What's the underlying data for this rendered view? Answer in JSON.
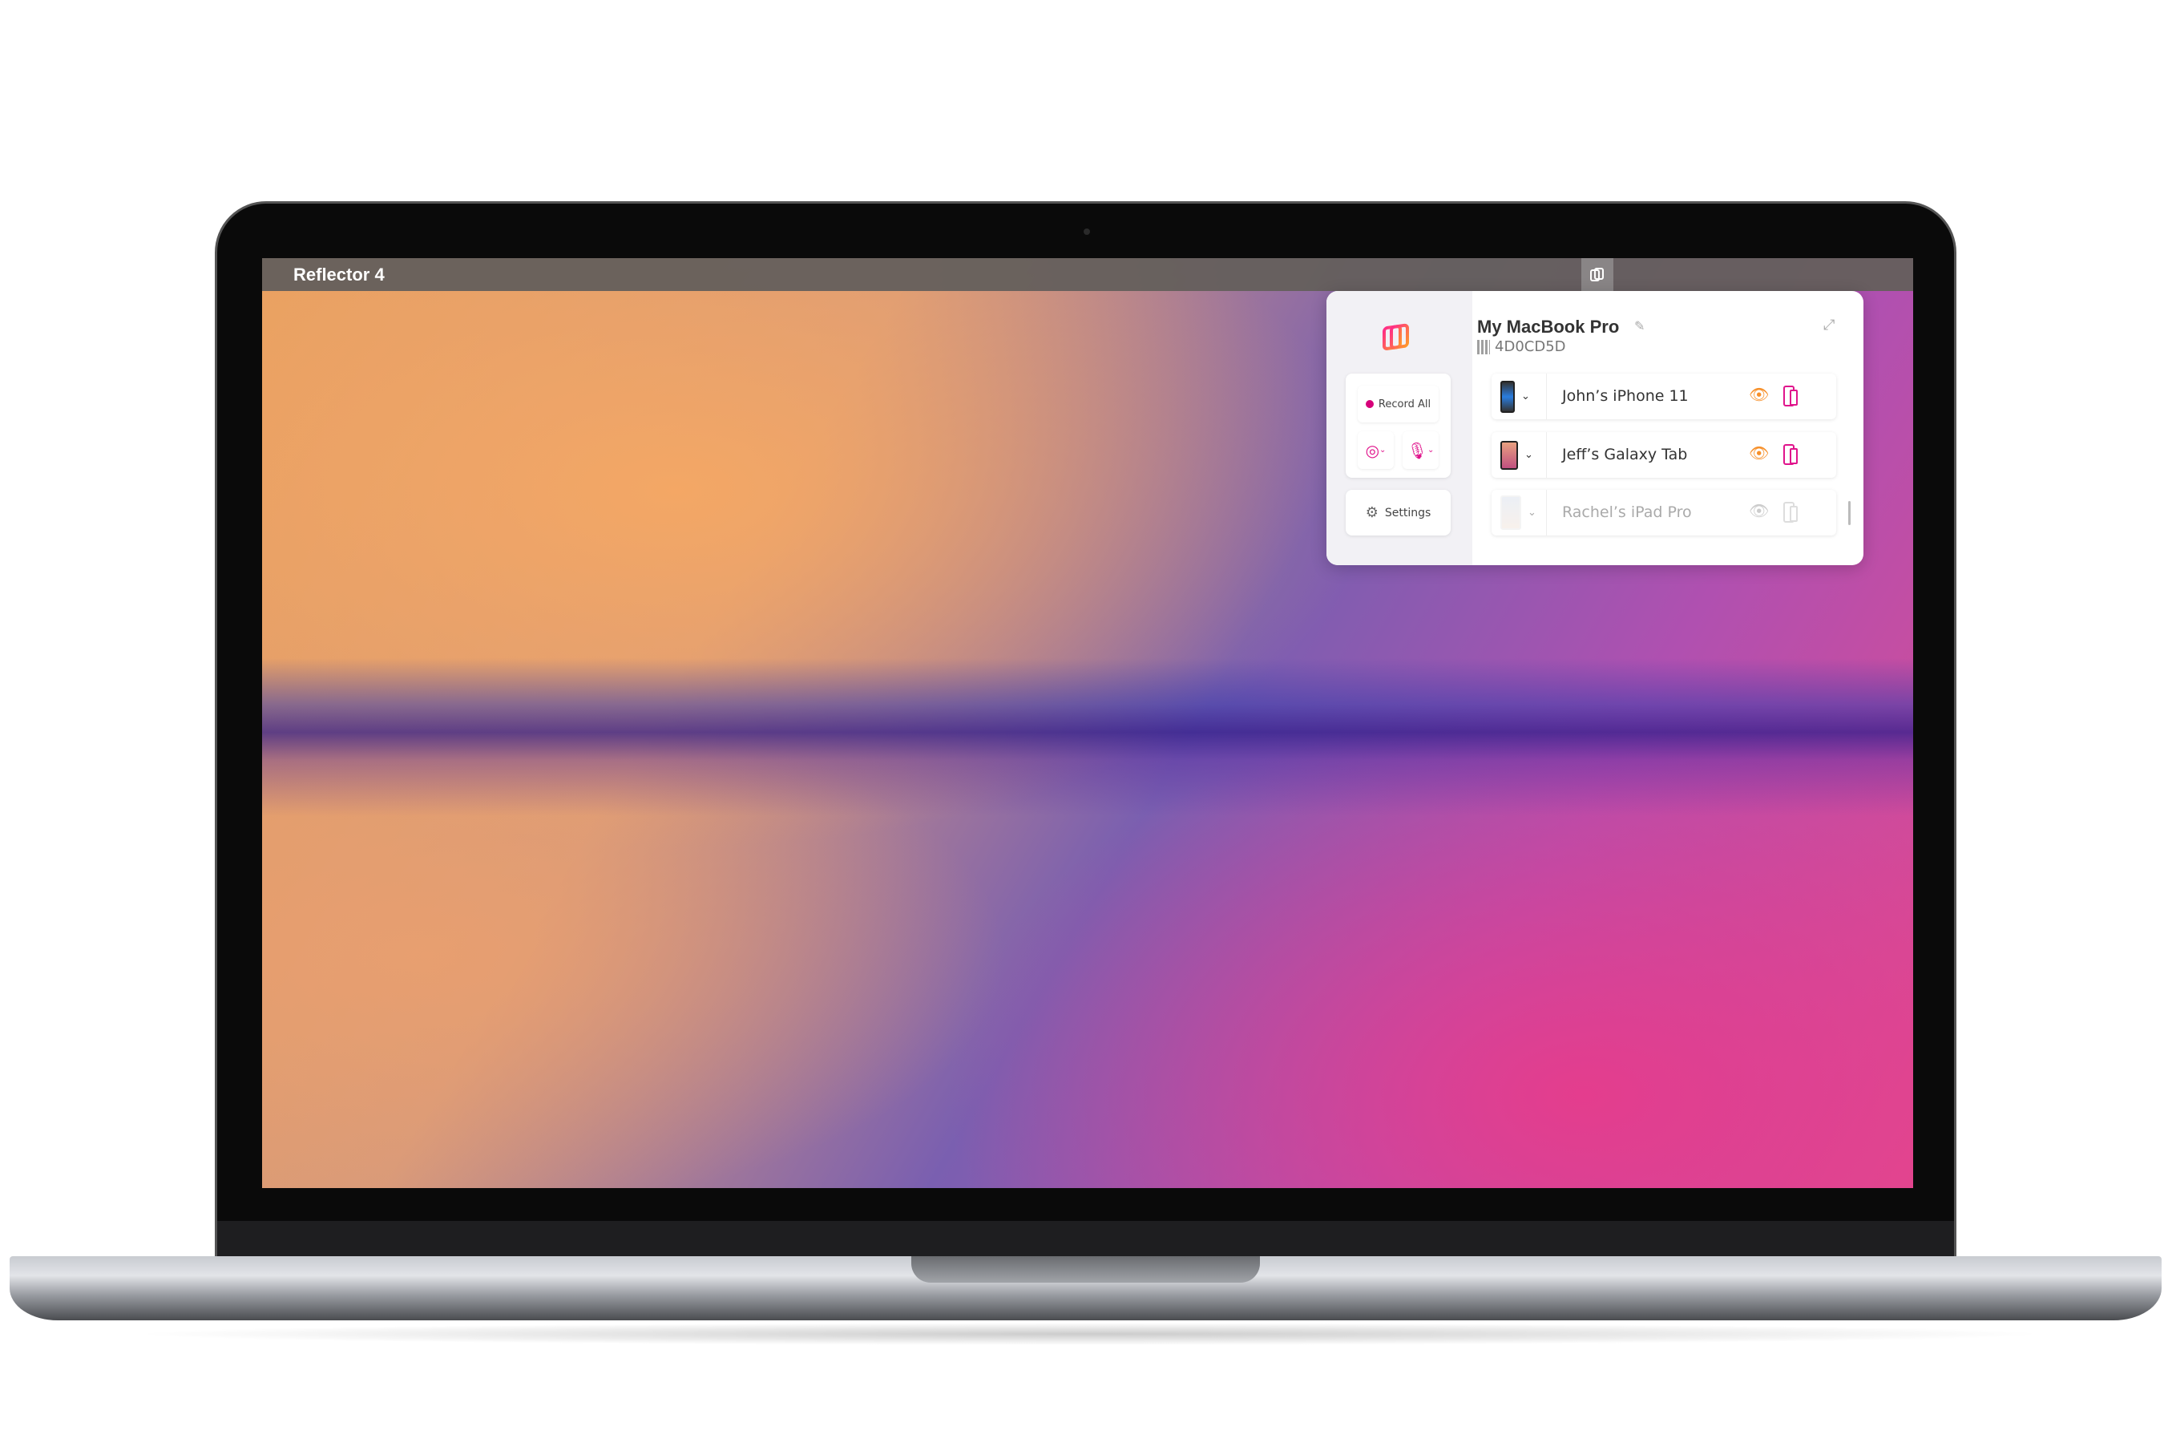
{
  "app": {
    "title": "Reflector 4",
    "menubar_icon": "reflector-logo-icon"
  },
  "panel": {
    "sidebar": {
      "record_all": "Record All",
      "camera_icon": "camera-icon",
      "mic_icon": "microphone-icon",
      "settings": "Settings"
    },
    "computer_name": "My MacBook Pro",
    "connection_code": "4D0CD5D",
    "devices": [
      {
        "name": "John’s iPhone 11",
        "active": true
      },
      {
        "name": "Jeff’s Galaxy Tab",
        "active": true
      },
      {
        "name": "Rachel’s iPad Pro",
        "active": false
      }
    ],
    "colors": {
      "accent_pink": "#e0148c",
      "accent_orange": "#f7902a"
    }
  }
}
